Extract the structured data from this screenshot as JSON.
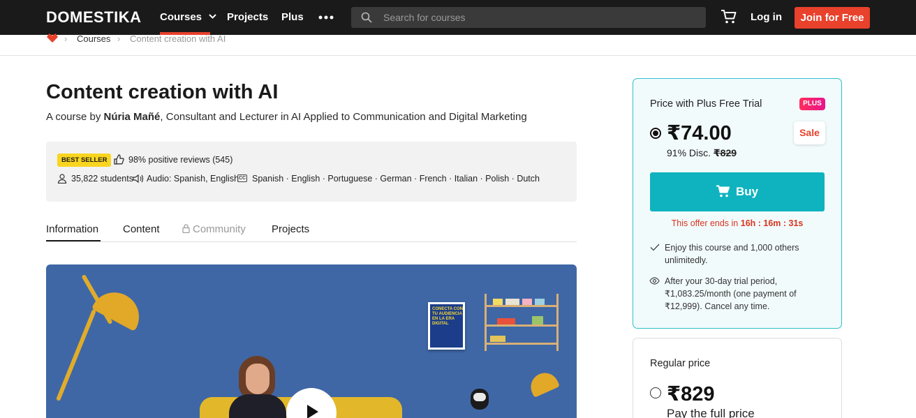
{
  "nav": {
    "logo": "DOMESTIKA",
    "courses": "Courses",
    "projects": "Projects",
    "plus": "Plus",
    "search_placeholder": "Search for courses",
    "login": "Log in",
    "join": "Join for Free"
  },
  "breadcrumb": {
    "courses": "Courses",
    "current": "Content creation with AI"
  },
  "course": {
    "title": "Content creation with AI",
    "byline_prefix": "A course by ",
    "author": "Núria Mañé",
    "byline_suffix": ", Consultant and Lecturer in AI Applied to Communication and Digital Marketing"
  },
  "stats": {
    "badge": "BEST SELLER",
    "reviews": "98% positive reviews (545)",
    "students": "35,822 students",
    "audio": "Audio: Spanish, English",
    "subtitles": "Spanish · English · Portuguese · German · French · Italian · Polish · Dutch"
  },
  "tabs": {
    "information": "Information",
    "content": "Content",
    "community": "Community",
    "projects": "Projects"
  },
  "video": {
    "poster_text": "CONECTA CON TU AUDIENCIA EN LA ERA DIGITAL"
  },
  "plus_card": {
    "title": "Price with Plus Free Trial",
    "badge": "PLUS",
    "price": "₹74.00",
    "sale": "Sale",
    "discount": "91% Disc.",
    "old_price": "₹829",
    "buy": "Buy",
    "offer_prefix": "This offer ends in ",
    "offer_time": "16h : 16m : 31s",
    "feature_1": "Enjoy this course and 1,000 others unlimitedly.",
    "feature_2": "After your 30-day trial period, ₹1,083.25/month (one payment of ₹12,999). Cancel any time.",
    "accent_color": "#0fb3bf"
  },
  "regular_card": {
    "title": "Regular price",
    "price": "₹829",
    "subtitle": "Pay the full price"
  },
  "colors": {
    "brand": "#e8412c",
    "nav_bg": "#1a1a1a",
    "best_seller": "#f9d51f"
  }
}
